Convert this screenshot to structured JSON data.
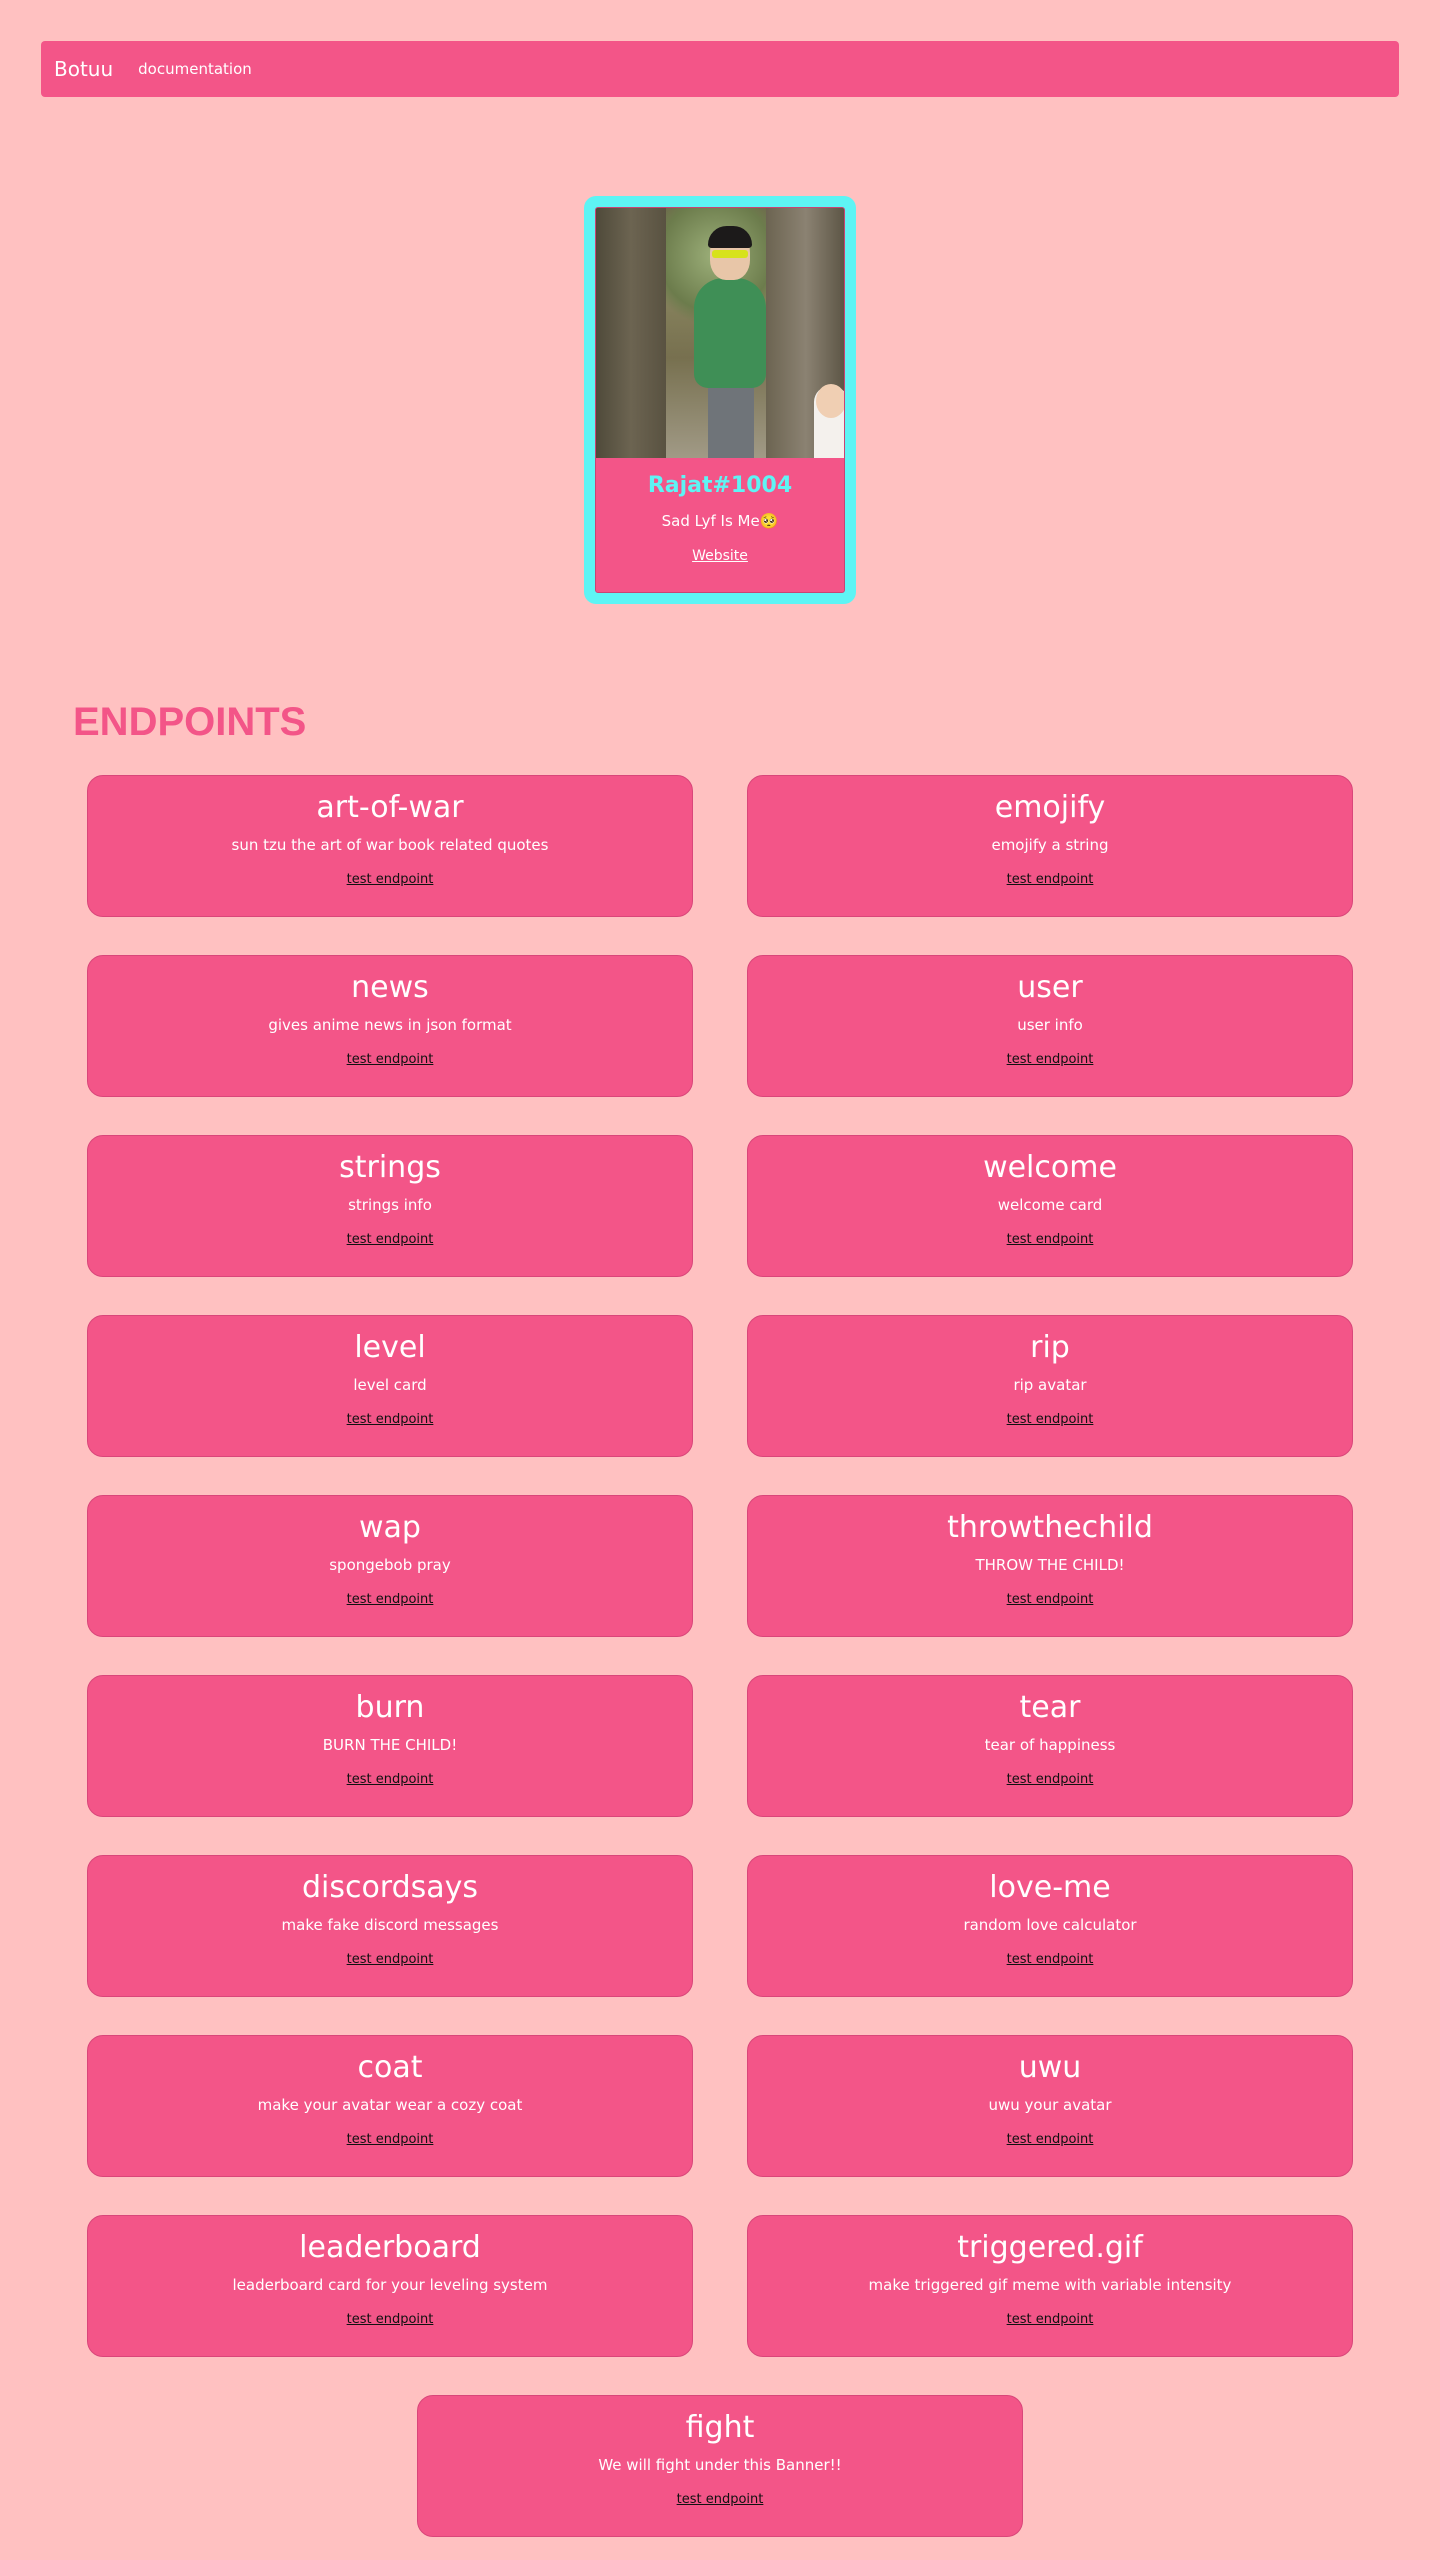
{
  "nav": {
    "brand": "Botuu",
    "documentation": "documentation"
  },
  "profile": {
    "name": "Rajat#1004",
    "status": "Sad Lyf Is Me🥺",
    "link": "Website"
  },
  "endpoints_title": "ENDPOINTS",
  "endpoints": [
    {
      "title": "art-of-war",
      "desc": "sun tzu the art of war book related quotes",
      "link": "test endpoint"
    },
    {
      "title": "emojify",
      "desc": "emojify a string",
      "link": "test endpoint"
    },
    {
      "title": "news",
      "desc": "gives anime news in json format",
      "link": "test endpoint"
    },
    {
      "title": "user",
      "desc": "user info",
      "link": "test endpoint"
    },
    {
      "title": "strings",
      "desc": "strings info",
      "link": "test endpoint"
    },
    {
      "title": "welcome",
      "desc": "welcome card",
      "link": "test endpoint"
    },
    {
      "title": "level",
      "desc": "level card",
      "link": "test endpoint"
    },
    {
      "title": "rip",
      "desc": "rip avatar",
      "link": "test endpoint"
    },
    {
      "title": "wap",
      "desc": "spongebob pray",
      "link": "test endpoint"
    },
    {
      "title": "throwthechild",
      "desc": "THROW THE CHILD!",
      "link": "test endpoint"
    },
    {
      "title": "burn",
      "desc": "BURN THE CHILD!",
      "link": "test endpoint"
    },
    {
      "title": "tear",
      "desc": "tear of happiness",
      "link": "test endpoint"
    },
    {
      "title": "discordsays",
      "desc": "make fake discord messages",
      "link": "test endpoint"
    },
    {
      "title": "love-me",
      "desc": "random love calculator",
      "link": "test endpoint"
    },
    {
      "title": "coat",
      "desc": "make your avatar wear a cozy coat",
      "link": "test endpoint"
    },
    {
      "title": "uwu",
      "desc": "uwu your avatar",
      "link": "test endpoint"
    },
    {
      "title": "leaderboard",
      "desc": "leaderboard card for your leveling system",
      "link": "test endpoint"
    },
    {
      "title": "triggered.gif",
      "desc": "make triggered gif meme with variable intensity",
      "link": "test endpoint"
    },
    {
      "title": "fight",
      "desc": "We will fight under this Banner!!",
      "link": "test endpoint"
    }
  ],
  "colors": {
    "background": "#ffc1c1",
    "accent": "#f35588",
    "profile_border": "#5ef4f4"
  }
}
